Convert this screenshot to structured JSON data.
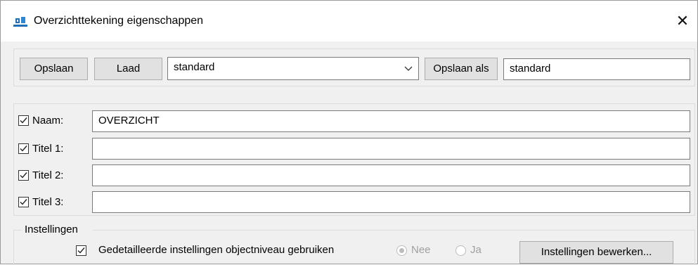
{
  "window": {
    "title": "Overzichttekening eigenschappen",
    "close_glyph": "✕",
    "icon": "drawing-app-icon"
  },
  "toolbar": {
    "save_label": "Opslaan",
    "load_label": "Laad",
    "preset_selected": "standard",
    "save_as_label": "Opslaan als",
    "save_as_value": "standard"
  },
  "fields": [
    {
      "label": "Naam:",
      "checked": true,
      "value": "OVERZICHT"
    },
    {
      "label": "Titel 1:",
      "checked": true,
      "value": ""
    },
    {
      "label": "Titel 2:",
      "checked": true,
      "value": ""
    },
    {
      "label": "Titel 3:",
      "checked": true,
      "value": ""
    }
  ],
  "settings": {
    "group_label": "Instellingen",
    "detailed_label": "Gedetailleerde instellingen objectniveau gebruiken",
    "detailed_checked": true,
    "option_no": "Nee",
    "option_yes": "Ja",
    "selected_option": "Nee",
    "edit_button": "Instellingen bewerken..."
  },
  "colors": {
    "accent_icon": "#1e6fb8",
    "dialog_bg": "#f0f0f0",
    "button_bg": "#e1e1e1"
  }
}
